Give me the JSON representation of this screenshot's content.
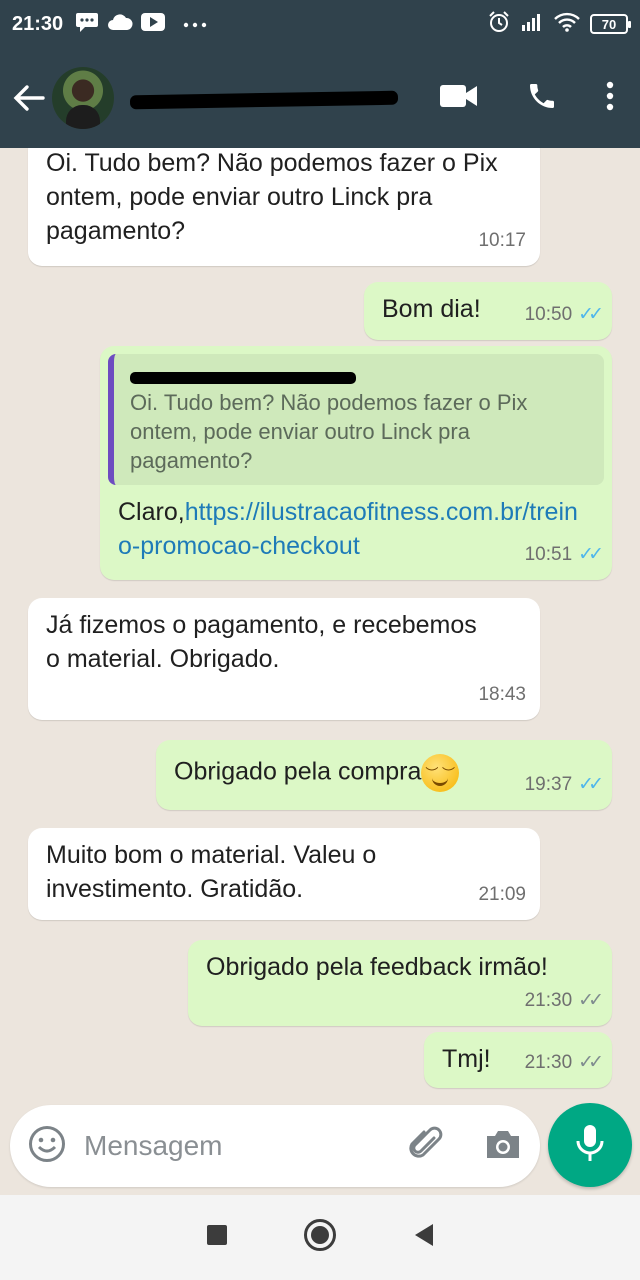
{
  "status_bar": {
    "time": "21:30",
    "battery": "70",
    "icons": [
      "chat-icon",
      "cloud-icon",
      "youtube-icon",
      "more-dots-icon",
      "alarm-icon",
      "signal-icon",
      "wifi-icon",
      "battery-icon"
    ]
  },
  "header": {
    "icons": [
      "back-arrow-icon",
      "video-call-icon",
      "phone-icon",
      "more-vert-icon"
    ]
  },
  "messages": [
    {
      "direction": "in",
      "text": "Oi. Tudo bem? Não podemos fazer o Pix ontem, pode enviar outro Linck pra pagamento?",
      "time": "10:17"
    },
    {
      "direction": "out",
      "text": "Bom dia!",
      "time": "10:50",
      "status": "read"
    },
    {
      "direction": "out",
      "quoted_text": "Oi. Tudo bem? Não podemos fazer o Pix ontem, pode enviar outro Linck pra pagamento?",
      "text_prefix": "Claro,",
      "link": "https://ilustracaofitness.com.br/treino-promocao-checkout",
      "time": "10:51",
      "status": "read"
    },
    {
      "direction": "in",
      "text": "Já fizemos o pagamento, e recebemos o material. Obrigado.",
      "time": "18:43"
    },
    {
      "direction": "out",
      "text": "Obrigado pela compra",
      "emoji": "smiling-face-emoji",
      "time": "19:37",
      "status": "read"
    },
    {
      "direction": "in",
      "text": "Muito bom o material. Valeu o investimento. Gratidão.",
      "time": "21:09"
    },
    {
      "direction": "out",
      "text": "Obrigado pela feedback irmão!",
      "time": "21:30",
      "status": "delivered"
    },
    {
      "direction": "out",
      "text": "Tmj!",
      "time": "21:30",
      "status": "delivered"
    }
  ],
  "input": {
    "placeholder": "Mensagem",
    "icons": [
      "emoji-icon",
      "attach-icon",
      "camera-icon",
      "mic-icon"
    ]
  },
  "nav": {
    "icons": [
      "recents-square-icon",
      "home-circle-icon",
      "back-triangle-icon"
    ]
  },
  "colors": {
    "header": "#30424c",
    "chat_bg": "#ece5dd",
    "bubble_in": "#ffffff",
    "bubble_out": "#dcf8c6",
    "read_ticks": "#4fb6ec",
    "link": "#1e7bb8",
    "mic_button": "#00a884",
    "quote_bar": "#6d4cc0"
  }
}
